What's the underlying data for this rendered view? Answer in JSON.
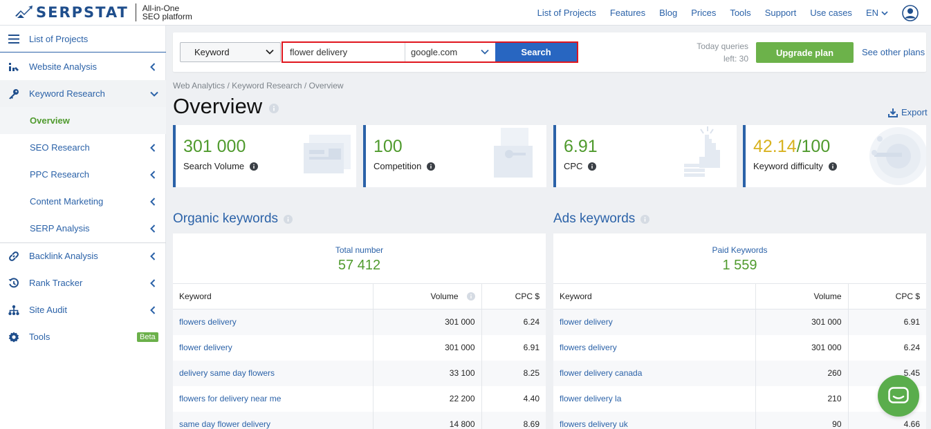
{
  "brand": {
    "name": "SERPSTAT",
    "tagline_line1": "All-in-One",
    "tagline_line2": "SEO platform"
  },
  "topnav": {
    "items": [
      "List of Projects",
      "Features",
      "Blog",
      "Prices",
      "Tools",
      "Support",
      "Use cases"
    ],
    "language": "EN"
  },
  "sidebar": {
    "list_projects": "List of Projects",
    "website_analysis": "Website Analysis",
    "keyword_research": "Keyword Research",
    "overview": "Overview",
    "seo_research": "SEO Research",
    "ppc_research": "PPC Research",
    "content_marketing": "Content Marketing",
    "serp_analysis": "SERP Analysis",
    "backlink_analysis": "Backlink Analysis",
    "rank_tracker": "Rank Tracker",
    "site_audit": "Site Audit",
    "tools": "Tools",
    "tools_badge": "Beta"
  },
  "search": {
    "type": "Keyword",
    "query": "flower delivery",
    "engine": "google.com",
    "button": "Search",
    "queries_line1": "Today queries",
    "queries_line2": "left: 30",
    "upgrade": "Upgrade plan",
    "other_plans": "See other plans"
  },
  "breadcrumb": "Web Analytics / Keyword Research / Overview",
  "page_title": "Overview",
  "export_label": "Export",
  "metrics": {
    "volume": {
      "value": "301 000",
      "label": "Search Volume"
    },
    "competition": {
      "value": "100",
      "label": "Competition"
    },
    "cpc": {
      "value": "6.91",
      "label": "CPC"
    },
    "difficulty": {
      "value": "42.14",
      "max": "/100",
      "label": "Keyword difficulty"
    }
  },
  "organic": {
    "title": "Organic keywords",
    "total_label": "Total number",
    "total_value": "57 412",
    "columns": [
      "Keyword",
      "Volume",
      "CPC $"
    ],
    "rows": [
      [
        "flowers delivery",
        "301 000",
        "6.24"
      ],
      [
        "flower delivery",
        "301 000",
        "6.91"
      ],
      [
        "delivery same day flowers",
        "33 100",
        "8.25"
      ],
      [
        "flowers for delivery near me",
        "22 200",
        "4.40"
      ],
      [
        "same day flower delivery",
        "14 800",
        "8.69"
      ]
    ]
  },
  "ads": {
    "title": "Ads keywords",
    "total_label": "Paid Keywords",
    "total_value": "1 559",
    "columns": [
      "Keyword",
      "Volume",
      "CPC $"
    ],
    "rows": [
      [
        "flower delivery",
        "301 000",
        "6.91"
      ],
      [
        "flowers delivery",
        "301 000",
        "6.24"
      ],
      [
        "flower delivery canada",
        "260",
        "5.45"
      ],
      [
        "flower delivery la",
        "210",
        ""
      ],
      [
        "flowers delivery uk",
        "90",
        "4.66"
      ]
    ]
  },
  "colors": {
    "accent": "#2b62a8",
    "green": "#4f9a2d",
    "highlight": "#e0151d",
    "kd_yellow": "#d8b21f"
  }
}
